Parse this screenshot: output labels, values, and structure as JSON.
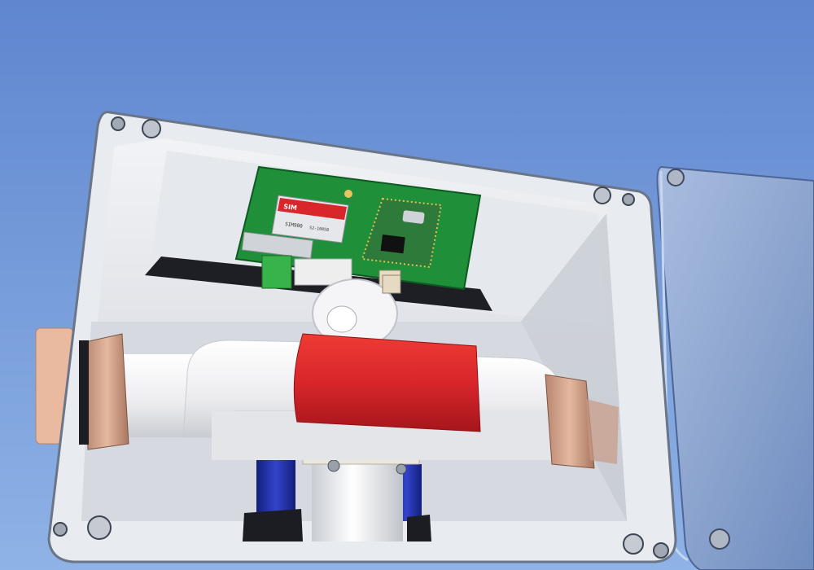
{
  "scene": {
    "background_top": "#5f86cf",
    "background_bottom": "#8fb3e6",
    "enclosure_color": "#e6e9ee",
    "enclosure_inner": "#d4d8de",
    "lid_color": "#8ea6cf",
    "pcb_color": "#1f8f3a",
    "module_red": "#d8262b",
    "pipe_color": "#f2f2f4",
    "band_color": "#df2a24",
    "brass_color": "#d7a488",
    "motor_blue": "#2233aa",
    "connector_green": "#38b34a"
  },
  "chip": {
    "brand": "SIM",
    "line1": "SIM900",
    "line2": "S2-10058"
  }
}
